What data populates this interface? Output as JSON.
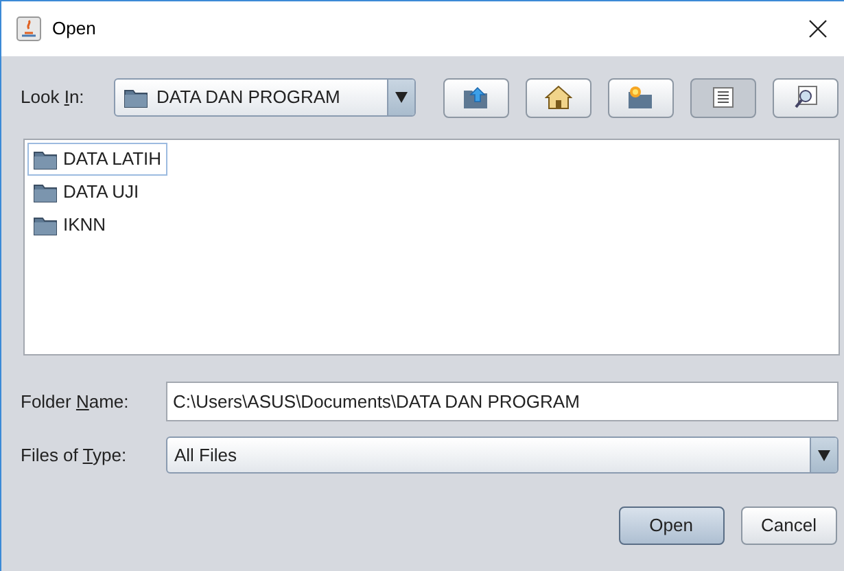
{
  "window": {
    "title": "Open"
  },
  "look_in": {
    "label": {
      "before": "Look ",
      "key": "I",
      "after": "n:"
    },
    "value": "DATA DAN PROGRAM"
  },
  "toolbar": [
    {
      "kind": "up",
      "selected": false
    },
    {
      "kind": "home",
      "selected": false
    },
    {
      "kind": "new_folder",
      "selected": false
    },
    {
      "kind": "list",
      "selected": true
    },
    {
      "kind": "details",
      "selected": false
    }
  ],
  "files": [
    {
      "name": "DATA LATIH",
      "selected": true
    },
    {
      "name": "DATA UJI",
      "selected": false
    },
    {
      "name": "IKNN",
      "selected": false
    }
  ],
  "folder_name": {
    "label": {
      "before": "Folder ",
      "key": "N",
      "after": "ame:"
    },
    "value": "C:\\Users\\ASUS\\Documents\\DATA DAN PROGRAM"
  },
  "file_type": {
    "label": {
      "before": "Files of ",
      "key": "T",
      "after": "ype:"
    },
    "value": "All Files"
  },
  "buttons": [
    {
      "label": "Open",
      "kind": "default"
    },
    {
      "label": "Cancel",
      "kind": "normal"
    }
  ]
}
